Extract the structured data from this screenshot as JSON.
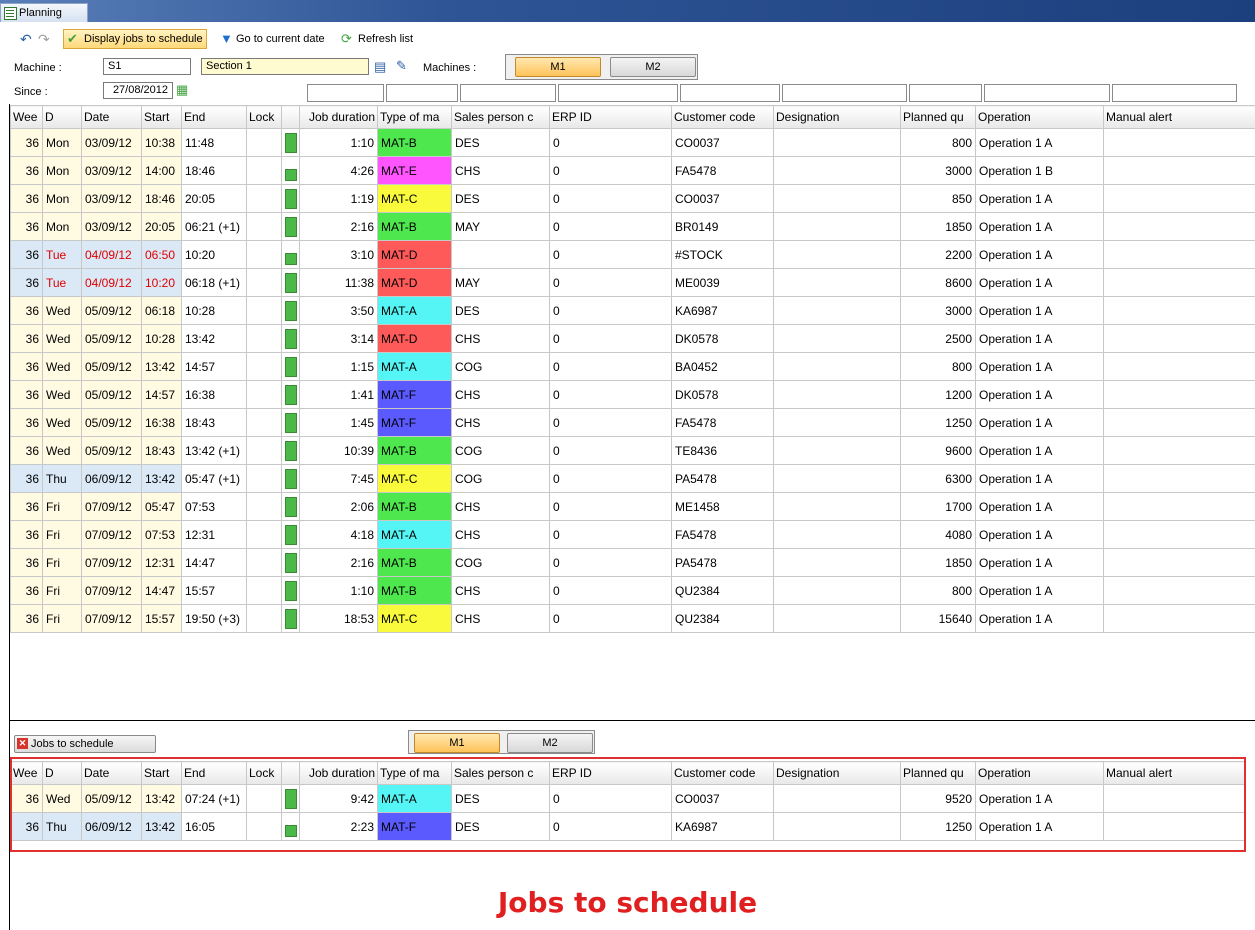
{
  "window": {
    "title": "Planning"
  },
  "toolbar": {
    "display_jobs_label": "Display jobs to schedule",
    "go_current_label": "Go to current date",
    "refresh_label": "Refresh list"
  },
  "filter_bar": {
    "machine_label": "Machine :",
    "machine_value": "S1",
    "section_value": "Section 1",
    "machines_label": "Machines :",
    "since_label": "Since :",
    "since_value": "27/08/2012"
  },
  "machine_tabs": [
    "M1",
    "M2"
  ],
  "columns": [
    "Wee",
    "D",
    "Date",
    "Start",
    "End",
    "Lock",
    "Job duration",
    "Type of ma",
    "Sales person c",
    "ERP ID",
    "Customer code",
    "Designation",
    "Planned qu",
    "Operation",
    "Manual alert"
  ],
  "type_colors": {
    "MAT-A": "#55f5f5",
    "MAT-B": "#4ee84e",
    "MAT-C": "#fafa3c",
    "MAT-D": "#ff5a5a",
    "MAT-E": "#ff55ff",
    "MAT-F": "#5a5aff"
  },
  "planning_rows": [
    {
      "week": "36",
      "day": "Mon",
      "date": "03/09/12",
      "start": "10:38",
      "end": "11:48",
      "lock": "full",
      "duration": "1:10",
      "type": "MAT-B",
      "sales": "DES",
      "erp": "0",
      "customer": "CO0037",
      "designation": "",
      "qty": "800",
      "operation": "Operation 1 A",
      "alert": "",
      "highlight": false
    },
    {
      "week": "36",
      "day": "Mon",
      "date": "03/09/12",
      "start": "14:00",
      "end": "18:46",
      "lock": "short",
      "duration": "4:26",
      "type": "MAT-E",
      "sales": "CHS",
      "erp": "0",
      "customer": "FA5478",
      "designation": "",
      "qty": "3000",
      "operation": "Operation 1 B",
      "alert": "",
      "highlight": false
    },
    {
      "week": "36",
      "day": "Mon",
      "date": "03/09/12",
      "start": "18:46",
      "end": "20:05",
      "lock": "full",
      "duration": "1:19",
      "type": "MAT-C",
      "sales": "DES",
      "erp": "0",
      "customer": "CO0037",
      "designation": "",
      "qty": "850",
      "operation": "Operation 1 A",
      "alert": "",
      "highlight": false
    },
    {
      "week": "36",
      "day": "Mon",
      "date": "03/09/12",
      "start": "20:05",
      "end": "06:21 (+1)",
      "lock": "full",
      "duration": "2:16",
      "type": "MAT-B",
      "sales": "MAY",
      "erp": "0",
      "customer": "BR0149",
      "designation": "",
      "qty": "1850",
      "operation": "Operation 1 A",
      "alert": "",
      "highlight": false
    },
    {
      "week": "36",
      "day": "Tue",
      "date": "04/09/12",
      "start": "06:50",
      "end": "10:20",
      "lock": "short",
      "duration": "3:10",
      "type": "MAT-D",
      "sales": "",
      "erp": "0",
      "customer": "#STOCK",
      "designation": "",
      "qty": "2200",
      "operation": "Operation 1 A",
      "alert": "",
      "highlight": true
    },
    {
      "week": "36",
      "day": "Tue",
      "date": "04/09/12",
      "start": "10:20",
      "end": "06:18 (+1)",
      "lock": "full",
      "duration": "11:38",
      "type": "MAT-D",
      "sales": "MAY",
      "erp": "0",
      "customer": "ME0039",
      "designation": "",
      "qty": "8600",
      "operation": "Operation 1 A",
      "alert": "",
      "highlight": true
    },
    {
      "week": "36",
      "day": "Wed",
      "date": "05/09/12",
      "start": "06:18",
      "end": "10:28",
      "lock": "full",
      "duration": "3:50",
      "type": "MAT-A",
      "sales": "DES",
      "erp": "0",
      "customer": "KA6987",
      "designation": "",
      "qty": "3000",
      "operation": "Operation 1 A",
      "alert": "",
      "highlight": false
    },
    {
      "week": "36",
      "day": "Wed",
      "date": "05/09/12",
      "start": "10:28",
      "end": "13:42",
      "lock": "full",
      "duration": "3:14",
      "type": "MAT-D",
      "sales": "CHS",
      "erp": "0",
      "customer": "DK0578",
      "designation": "",
      "qty": "2500",
      "operation": "Operation 1 A",
      "alert": "",
      "highlight": false
    },
    {
      "week": "36",
      "day": "Wed",
      "date": "05/09/12",
      "start": "13:42",
      "end": "14:57",
      "lock": "full",
      "duration": "1:15",
      "type": "MAT-A",
      "sales": "COG",
      "erp": "0",
      "customer": "BA0452",
      "designation": "",
      "qty": "800",
      "operation": "Operation 1 A",
      "alert": "",
      "highlight": false
    },
    {
      "week": "36",
      "day": "Wed",
      "date": "05/09/12",
      "start": "14:57",
      "end": "16:38",
      "lock": "full",
      "duration": "1:41",
      "type": "MAT-F",
      "sales": "CHS",
      "erp": "0",
      "customer": "DK0578",
      "designation": "",
      "qty": "1200",
      "operation": "Operation 1 A",
      "alert": "",
      "highlight": false
    },
    {
      "week": "36",
      "day": "Wed",
      "date": "05/09/12",
      "start": "16:38",
      "end": "18:43",
      "lock": "full",
      "duration": "1:45",
      "type": "MAT-F",
      "sales": "CHS",
      "erp": "0",
      "customer": "FA5478",
      "designation": "",
      "qty": "1250",
      "operation": "Operation 1 A",
      "alert": "",
      "highlight": false
    },
    {
      "week": "36",
      "day": "Wed",
      "date": "05/09/12",
      "start": "18:43",
      "end": "13:42 (+1)",
      "lock": "full",
      "duration": "10:39",
      "type": "MAT-B",
      "sales": "COG",
      "erp": "0",
      "customer": "TE8436",
      "designation": "",
      "qty": "9600",
      "operation": "Operation 1 A",
      "alert": "",
      "highlight": false
    },
    {
      "week": "36",
      "day": "Thu",
      "date": "06/09/12",
      "start": "13:42",
      "end": "05:47 (+1)",
      "lock": "full",
      "duration": "7:45",
      "type": "MAT-C",
      "sales": "COG",
      "erp": "0",
      "customer": "PA5478",
      "designation": "",
      "qty": "6300",
      "operation": "Operation 1 A",
      "alert": "",
      "highlight": false,
      "thu": true
    },
    {
      "week": "36",
      "day": "Fri",
      "date": "07/09/12",
      "start": "05:47",
      "end": "07:53",
      "lock": "full",
      "duration": "2:06",
      "type": "MAT-B",
      "sales": "CHS",
      "erp": "0",
      "customer": "ME1458",
      "designation": "",
      "qty": "1700",
      "operation": "Operation 1 A",
      "alert": "",
      "highlight": false
    },
    {
      "week": "36",
      "day": "Fri",
      "date": "07/09/12",
      "start": "07:53",
      "end": "12:31",
      "lock": "full",
      "duration": "4:18",
      "type": "MAT-A",
      "sales": "CHS",
      "erp": "0",
      "customer": "FA5478",
      "designation": "",
      "qty": "4080",
      "operation": "Operation 1 A",
      "alert": "",
      "highlight": false
    },
    {
      "week": "36",
      "day": "Fri",
      "date": "07/09/12",
      "start": "12:31",
      "end": "14:47",
      "lock": "full",
      "duration": "2:16",
      "type": "MAT-B",
      "sales": "COG",
      "erp": "0",
      "customer": "PA5478",
      "designation": "",
      "qty": "1850",
      "operation": "Operation 1 A",
      "alert": "",
      "highlight": false
    },
    {
      "week": "36",
      "day": "Fri",
      "date": "07/09/12",
      "start": "14:47",
      "end": "15:57",
      "lock": "full",
      "duration": "1:10",
      "type": "MAT-B",
      "sales": "CHS",
      "erp": "0",
      "customer": "QU2384",
      "designation": "",
      "qty": "800",
      "operation": "Operation 1 A",
      "alert": "",
      "highlight": false
    },
    {
      "week": "36",
      "day": "Fri",
      "date": "07/09/12",
      "start": "15:57",
      "end": "19:50 (+3)",
      "lock": "full",
      "duration": "18:53",
      "type": "MAT-C",
      "sales": "CHS",
      "erp": "0",
      "customer": "QU2384",
      "designation": "",
      "qty": "15640",
      "operation": "Operation 1 A",
      "alert": "",
      "highlight": false
    }
  ],
  "jobs_button_label": "Jobs to schedule",
  "jobs_rows": [
    {
      "week": "36",
      "day": "Wed",
      "date": "05/09/12",
      "start": "13:42",
      "end": "07:24 (+1)",
      "lock": "full",
      "duration": "9:42",
      "type": "MAT-A",
      "sales": "DES",
      "erp": "0",
      "customer": "CO0037",
      "designation": "",
      "qty": "9520",
      "operation": "Operation 1 A",
      "alert": "",
      "highlight": false
    },
    {
      "week": "36",
      "day": "Thu",
      "date": "06/09/12",
      "start": "13:42",
      "end": "16:05",
      "lock": "short",
      "duration": "2:23",
      "type": "MAT-F",
      "sales": "DES",
      "erp": "0",
      "customer": "KA6987",
      "designation": "",
      "qty": "1250",
      "operation": "Operation 1 A",
      "alert": "",
      "highlight": false,
      "thu": true
    }
  ],
  "caption": "Jobs to schedule"
}
